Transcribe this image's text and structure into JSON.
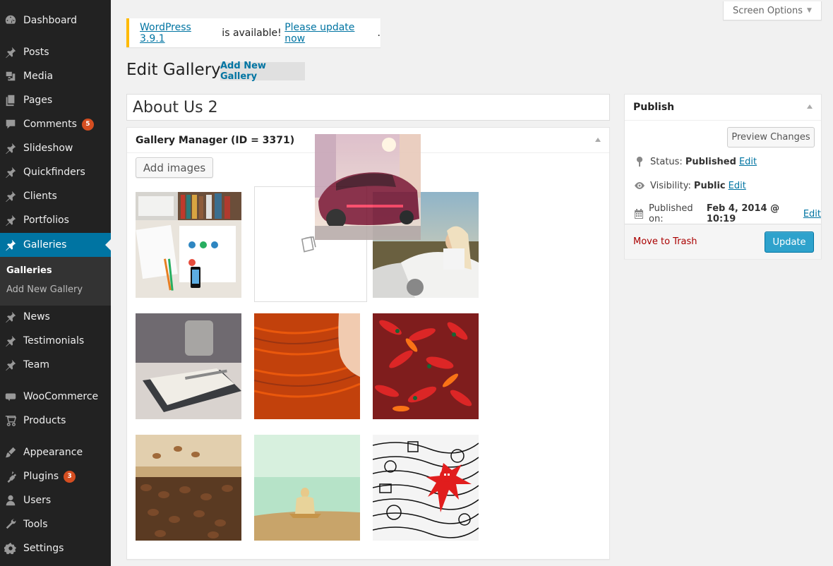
{
  "sidebar": {
    "items": [
      {
        "label": "Dashboard",
        "icon": "dashboard-icon"
      },
      {
        "label": "Posts",
        "icon": "pin-icon"
      },
      {
        "label": "Media",
        "icon": "media-icon"
      },
      {
        "label": "Pages",
        "icon": "pages-icon"
      },
      {
        "label": "Comments",
        "icon": "comments-icon",
        "badge": "5"
      },
      {
        "label": "Slideshow",
        "icon": "pin-icon"
      },
      {
        "label": "Quickfinders",
        "icon": "pin-icon"
      },
      {
        "label": "Clients",
        "icon": "pin-icon"
      },
      {
        "label": "Portfolios",
        "icon": "pin-icon"
      },
      {
        "label": "Galleries",
        "icon": "pin-icon",
        "current": true
      },
      {
        "label": "News",
        "icon": "pin-icon"
      },
      {
        "label": "Testimonials",
        "icon": "pin-icon"
      },
      {
        "label": "Team",
        "icon": "pin-icon"
      },
      {
        "label": "WooCommerce",
        "icon": "woocommerce-icon"
      },
      {
        "label": "Products",
        "icon": "cart-icon"
      },
      {
        "label": "Appearance",
        "icon": "appearance-icon"
      },
      {
        "label": "Plugins",
        "icon": "plugins-icon",
        "badge": "3"
      },
      {
        "label": "Users",
        "icon": "users-icon"
      },
      {
        "label": "Tools",
        "icon": "tools-icon"
      },
      {
        "label": "Settings",
        "icon": "settings-icon"
      }
    ],
    "submenu": [
      {
        "label": "Galleries",
        "current": true
      },
      {
        "label": "Add New Gallery"
      }
    ]
  },
  "header": {
    "screen_options": "Screen Options",
    "nag": {
      "link1": "WordPress 3.9.1",
      "middle": " is available! ",
      "link2": "Please update now",
      "end": "."
    },
    "page_title": "Edit Gallery",
    "add_new": "Add New Gallery"
  },
  "editor": {
    "title_value": "About Us 2",
    "gallery_manager_title": "Gallery Manager (ID = 3371)",
    "add_images_label": "Add images",
    "images": [
      "desk-with-laptop-and-books",
      "red-sports-car (being dragged)",
      "woman-in-convertible",
      "notebook-and-pen-on-desk",
      "red-hair-woman-profile",
      "red-chili-peppers",
      "coffee-beans",
      "person-sitting-by-sea",
      "doodle-art-red-figure"
    ]
  },
  "publish": {
    "title": "Publish",
    "preview_label": "Preview Changes",
    "status_label": "Status:",
    "status_value": "Published",
    "visibility_label": "Visibility:",
    "visibility_value": "Public",
    "published_label": "Published on:",
    "published_value": "Feb 4, 2014 @ 10:19",
    "edit_label": "Edit",
    "trash_label": "Move to Trash",
    "update_label": "Update"
  },
  "colors": {
    "sidebar_bg": "#222222",
    "accent": "#0074a2",
    "badge": "#d54e21",
    "primary_button": "#2ea2cc",
    "nag_border": "#ffba00"
  }
}
